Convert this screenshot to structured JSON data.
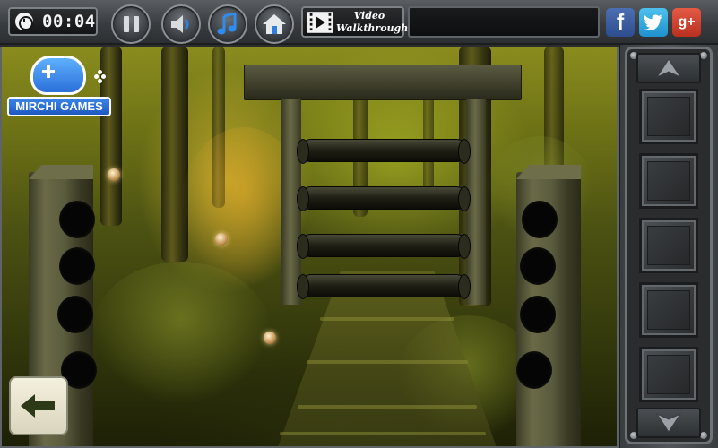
{
  "topbar": {
    "timer": "00:04",
    "buttons": {
      "pause": "pause-icon",
      "sound": "speaker-icon",
      "music": "music-note-icon",
      "home": "home-icon"
    },
    "video_walkthrough": {
      "line1": "Video",
      "line2": "Walkthrough"
    },
    "social": {
      "facebook": "f",
      "twitter": "t",
      "googleplus": "g+"
    }
  },
  "logo": {
    "text": "MIRCHI GAMES"
  },
  "scene": {
    "gate_bars": 4,
    "left_post_holes": 4,
    "right_post_holes": 4,
    "orbs": 3
  },
  "inventory": {
    "slots": 5
  },
  "colors": {
    "accent_blue": "#2b6fd8",
    "facebook": "#3b5998",
    "twitter": "#1da1f2",
    "googleplus": "#dd4b39",
    "forest": "#6f7316"
  }
}
